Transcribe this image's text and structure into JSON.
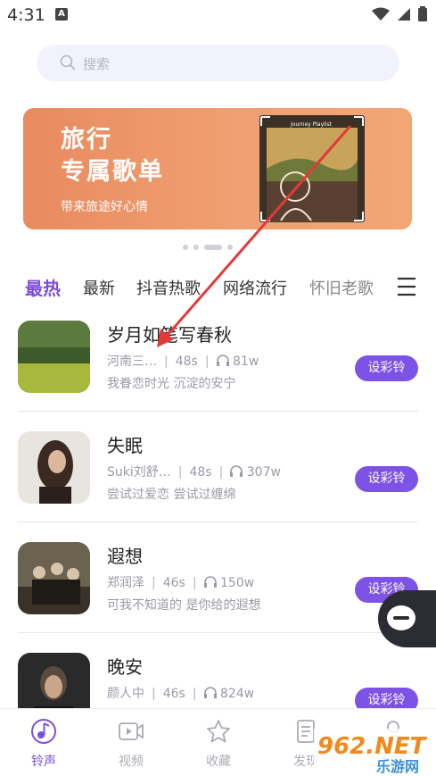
{
  "status_bar": {
    "time": "4:31",
    "notif_letter": "A"
  },
  "search": {
    "placeholder": "搜索"
  },
  "banner": {
    "title_line1": "旅行",
    "title_line2": "专属歌单",
    "subtitle": "带来旅途好心情",
    "art_caption": "Journey Playlist"
  },
  "carousel": {
    "count": 4,
    "active_index": 2
  },
  "tabs": [
    {
      "label": "最热",
      "active": true
    },
    {
      "label": "最新",
      "active": false
    },
    {
      "label": "抖音热歌",
      "active": false
    },
    {
      "label": "网络流行",
      "active": false
    },
    {
      "label": "怀旧老歌",
      "active": false
    }
  ],
  "songs": [
    {
      "title": "岁月如笔写春秋",
      "artist": "河南三…",
      "duration": "48s",
      "plays": "81w",
      "lyric": "我眷恋时光 沉淀的安宁",
      "button": "设彩铃"
    },
    {
      "title": "失眠",
      "artist": "Suki刘舒…",
      "duration": "48s",
      "plays": "307w",
      "lyric": "尝试过爱恋 尝试过缠绵",
      "button": "设彩铃"
    },
    {
      "title": "遐想",
      "artist": "郑润泽",
      "duration": "46s",
      "plays": "150w",
      "lyric": "可我不知道的 是你给的遐想",
      "button": "设彩铃"
    },
    {
      "title": "晚安",
      "artist": "颜人中",
      "duration": "46s",
      "plays": "824w",
      "lyric": "",
      "button": "设彩铃"
    }
  ],
  "bottom_nav": [
    {
      "label": "铃声",
      "icon": "music-note-icon",
      "active": true
    },
    {
      "label": "视频",
      "icon": "video-icon",
      "active": false
    },
    {
      "label": "收藏",
      "icon": "star-icon",
      "active": false
    },
    {
      "label": "发现",
      "icon": "discover-icon",
      "active": false
    },
    {
      "label": "我的",
      "icon": "user-icon",
      "active": false
    }
  ],
  "watermark": {
    "text": "962.NET",
    "sub": "乐游网"
  },
  "colors": {
    "accent": "#7d52e6",
    "banner_start": "#e98a5f",
    "banner_end": "#f3a675",
    "arrow": "#e03a3a"
  }
}
